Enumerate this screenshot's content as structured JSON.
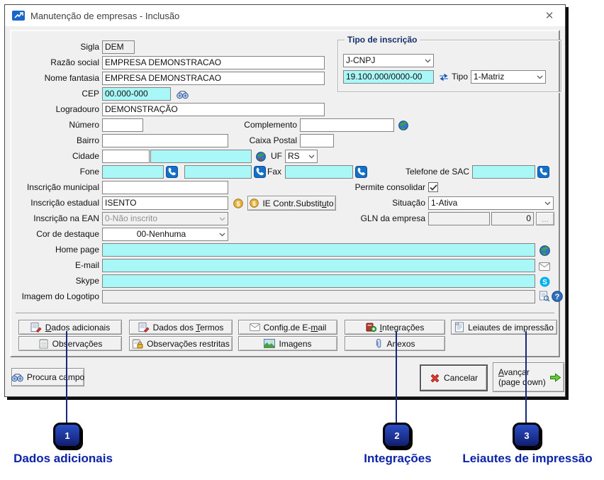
{
  "window": {
    "title": "Manutenção de empresas - Inclusão",
    "close_glyph": "✕"
  },
  "fields": {
    "sigla": {
      "label": "Sigla",
      "value": "DEM"
    },
    "razao_social": {
      "label": "Razão social",
      "value": "EMPRESA DEMONSTRACAO"
    },
    "nome_fantasia": {
      "label": "Nome fantasia",
      "value": "EMPRESA DEMONSTRACAO"
    },
    "cep": {
      "label": "CEP",
      "value": "00.000-000"
    },
    "logradouro": {
      "label": "Logradouro",
      "value": "DEMONSTRAÇÃO"
    },
    "numero": {
      "label": "Número",
      "value": ""
    },
    "complemento": {
      "label": "Complemento",
      "value": ""
    },
    "bairro": {
      "label": "Bairro",
      "value": ""
    },
    "caixa_postal": {
      "label": "Caixa Postal",
      "value": ""
    },
    "cidade": {
      "label": "Cidade",
      "code": "",
      "name": ""
    },
    "uf": {
      "label": "UF",
      "value": "RS"
    },
    "fone": {
      "label": "Fone",
      "value1": "",
      "value2": ""
    },
    "fax": {
      "label": "Fax",
      "value": ""
    },
    "telefone_sac": {
      "label": "Telefone de SAC",
      "value": ""
    },
    "inscricao_municipal": {
      "label": "Inscrição municipal",
      "value": ""
    },
    "permite_consolidar": {
      "label": "Permite consolidar",
      "checked": true
    },
    "inscricao_estadual": {
      "label": "Inscrição estadual",
      "value": "ISENTO"
    },
    "situacao": {
      "label": "Situação",
      "value": "1-Ativa"
    },
    "inscricao_ean": {
      "label": "Inscrição na EAN",
      "value": "0-Não inscrito"
    },
    "gln": {
      "label": "GLN da empresa",
      "value1": "",
      "value2": "0",
      "browse_label": "..."
    },
    "cor_destaque": {
      "label": "Cor de destaque",
      "value": "00-Nenhuma"
    },
    "home_page": {
      "label": "Home page",
      "value": ""
    },
    "email": {
      "label": "E-mail",
      "value": ""
    },
    "skype": {
      "label": "Skype",
      "value": ""
    },
    "logotipo": {
      "label": "Imagem do Logotipo",
      "value": ""
    }
  },
  "tipo_inscricao": {
    "title": "Tipo de inscrição",
    "doc_type": "J-CNPJ",
    "number": "19.100.000/0000-00",
    "tipo_label": "Tipo",
    "tipo_value": "1-Matriz"
  },
  "buttons": {
    "ie_substituto": {
      "pre": "IE Contr.Substit",
      "key": "u",
      "post": "to"
    },
    "grid": [
      {
        "pre": "",
        "key": "D",
        "post": "ados adicionais"
      },
      {
        "pre": "Dados dos ",
        "key": "T",
        "post": "ermos"
      },
      {
        "pre": "Config.de E-",
        "key": "m",
        "post": "ail"
      },
      {
        "pre": "",
        "key": "I",
        "post": "ntegrações"
      },
      {
        "pre": "Leiautes de impressão",
        "key": "",
        "post": ""
      },
      {
        "pre": "Observações",
        "key": "",
        "post": ""
      },
      {
        "pre": "Observações restritas",
        "key": "",
        "post": ""
      },
      {
        "pre": "Imagens",
        "key": "",
        "post": ""
      },
      {
        "pre": "Anexos",
        "key": "",
        "post": ""
      }
    ]
  },
  "footer": {
    "procura_campo": "Procura campo",
    "cancelar": "Cancelar",
    "avancar": {
      "pre": "",
      "key": "A",
      "post": "vançar",
      "line2": "(page down)"
    }
  },
  "callouts": [
    {
      "number": "1",
      "label": "Dados adicionais"
    },
    {
      "number": "2",
      "label": "Integrações"
    },
    {
      "number": "3",
      "label": "Leiautes de impressão"
    }
  ],
  "colors": {
    "field_highlight": "#a9f7f7",
    "callout_fill": "#16339e",
    "annotation_text": "#0b23a8",
    "connector_line": "#16277e"
  }
}
